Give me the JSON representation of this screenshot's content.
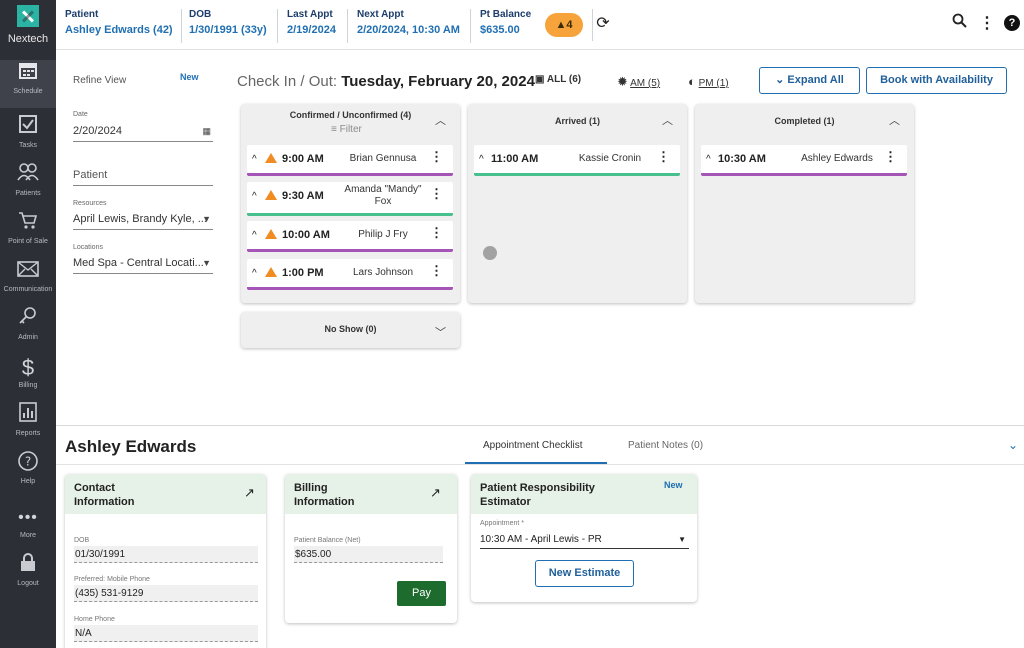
{
  "brand": {
    "name": "Nextech"
  },
  "nav": {
    "items": [
      {
        "label": "Schedule",
        "icon": "calendar-icon"
      },
      {
        "label": "Tasks",
        "icon": "checkbox-icon"
      },
      {
        "label": "Patients",
        "icon": "people-icon"
      },
      {
        "label": "Point of Sale",
        "icon": "cart-icon"
      },
      {
        "label": "Communication",
        "icon": "envelope-icon"
      },
      {
        "label": "Admin",
        "icon": "key-icon"
      },
      {
        "label": "Billing",
        "icon": "dollar-icon"
      },
      {
        "label": "Reports",
        "icon": "chart-icon"
      },
      {
        "label": "Help",
        "icon": "help-icon"
      },
      {
        "label": "More",
        "icon": "more-dots-icon"
      },
      {
        "label": "Logout",
        "icon": "lock-icon"
      }
    ]
  },
  "header": {
    "patient_label": "Patient",
    "patient_value": "Ashley Edwards (42)",
    "dob_label": "DOB",
    "dob_value": "1/30/1991 (33y)",
    "last_label": "Last Appt",
    "last_value": "2/19/2024",
    "next_label": "Next Appt",
    "next_value": "2/20/2024, 10:30 AM",
    "balance_label": "Pt Balance",
    "balance_value": "$635.00",
    "alert_count": "4"
  },
  "filters": {
    "title": "Refine View",
    "new_label": "New",
    "date_label": "Date",
    "date_value": "2/20/2024",
    "patient_placeholder": "Patient",
    "resources_label": "Resources",
    "resources_value": "April Lewis, Brandy Kyle, ...",
    "locations_label": "Locations",
    "locations_value": "Med Spa - Central Locati..."
  },
  "board": {
    "title_prefix": "Check In / Out:",
    "title_date": "Tuesday, February 20, 2024",
    "all_label": "ALL (6)",
    "am_label": "AM (5)",
    "pm_label": "PM (1)",
    "expand_label": "Expand All",
    "book_label": "Book with Availability",
    "columns": [
      {
        "title": "Confirmed / Unconfirmed (4)",
        "filter_label": "Filter",
        "appointments": [
          {
            "time": "9:00 AM",
            "name": "Brian Gennusa"
          },
          {
            "time": "9:30 AM",
            "name": "Amanda \"Mandy\" Fox"
          },
          {
            "time": "10:00 AM",
            "name": "Philip J Fry"
          },
          {
            "time": "1:00 PM",
            "name": "Lars Johnson"
          }
        ]
      },
      {
        "title": "Arrived (1)",
        "appointments": [
          {
            "time": "11:00 AM",
            "name": "Kassie Cronin"
          }
        ]
      },
      {
        "title": "Completed (1)",
        "appointments": [
          {
            "time": "10:30 AM",
            "name": "Ashley Edwards"
          }
        ]
      }
    ],
    "noshow_title": "No Show (0)"
  },
  "detail": {
    "patient_name": "Ashley Edwards",
    "tab_checklist": "Appointment Checklist",
    "tab_notes": "Patient Notes (0)",
    "contact": {
      "title_line1": "Contact",
      "title_line2": "Information",
      "dob_label": "DOB",
      "dob_value": "01/30/1991",
      "mobile_label": "Preferred: Mobile Phone",
      "mobile_value": "(435) 531-9129",
      "home_label": "Home Phone",
      "home_value": "N/A"
    },
    "billing": {
      "title_line1": "Billing",
      "title_line2": "Information",
      "balance_label": "Patient Balance (Net)",
      "balance_value": "$635.00",
      "pay_label": "Pay"
    },
    "estimator": {
      "title_line1": "Patient Responsibility",
      "title_line2": "Estimator",
      "new_label": "New",
      "appointment_label": "Appointment *",
      "appointment_value": "10:30 AM - April Lewis - PR",
      "new_estimate_label": "New Estimate"
    }
  }
}
